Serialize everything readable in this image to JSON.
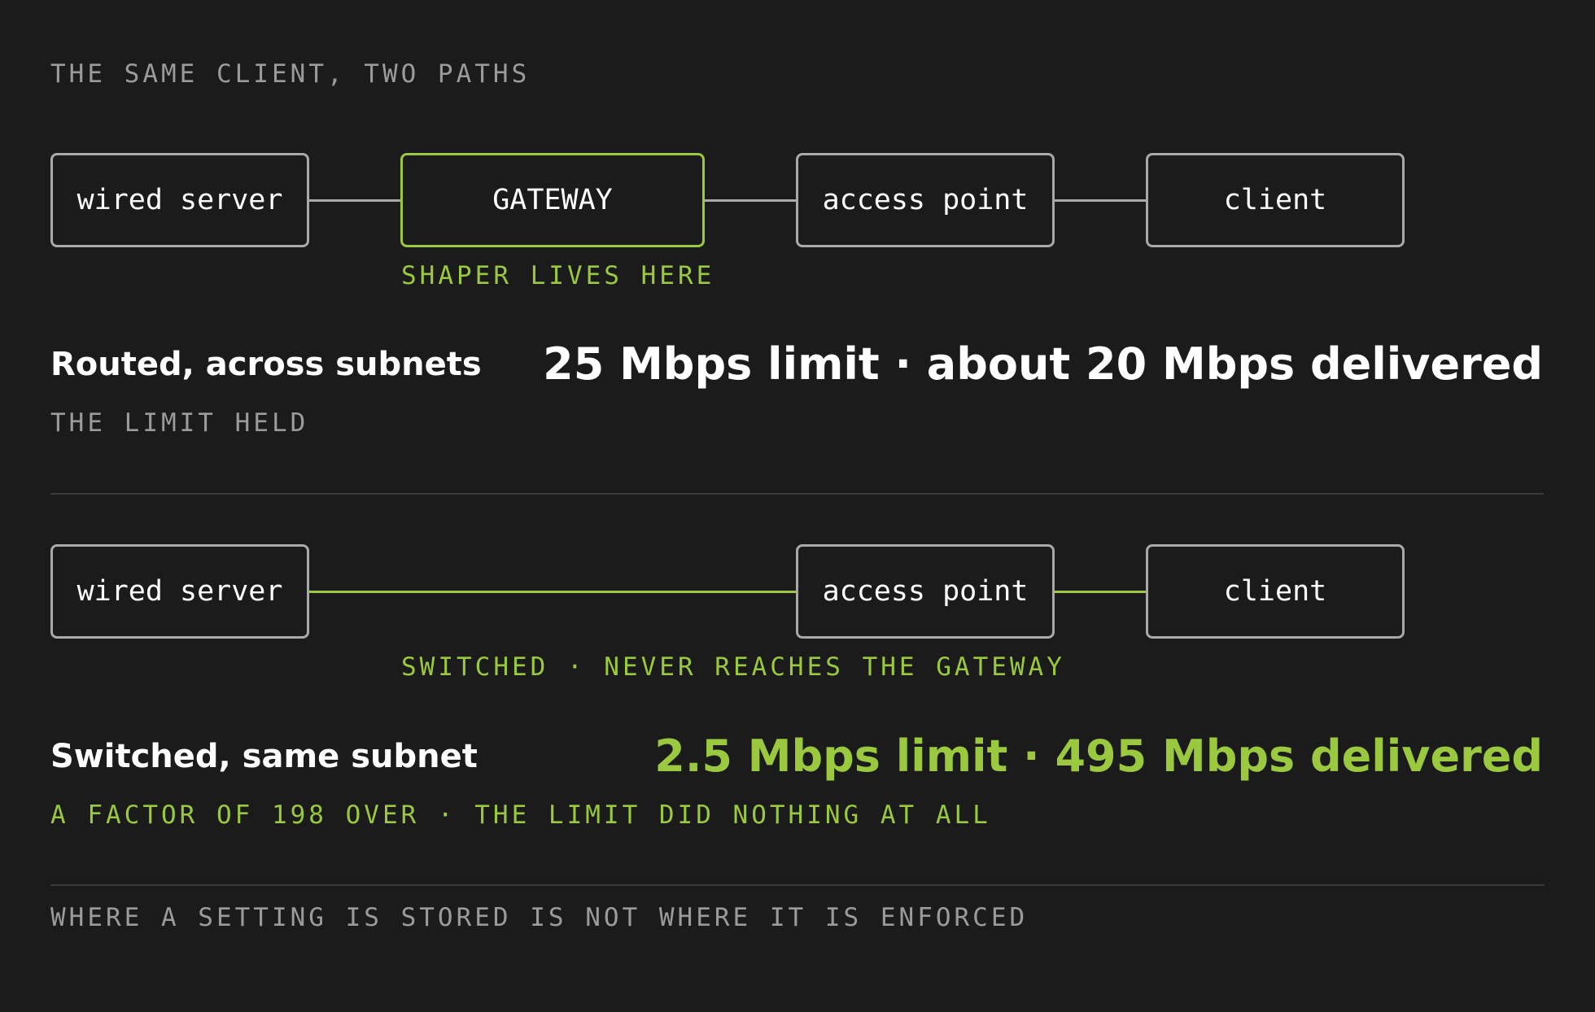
{
  "title": "THE SAME CLIENT, TWO PATHS",
  "routed": {
    "nodes": {
      "server": "wired server",
      "gateway": "GATEWAY",
      "access_point": "access point",
      "client": "client"
    },
    "gateway_note": "SHAPER LIVES HERE",
    "heading": "Routed, across subnets",
    "result": "25 Mbps limit · about 20 Mbps delivered",
    "verdict": "THE LIMIT HELD"
  },
  "switched": {
    "nodes": {
      "server": "wired server",
      "access_point": "access point",
      "client": "client"
    },
    "path_note": "SWITCHED · NEVER REACHES THE GATEWAY",
    "heading": "Switched, same subnet",
    "result": "2.5 Mbps limit · 495 Mbps delivered",
    "verdict": "A FACTOR OF 198 OVER · THE LIMIT DID NOTHING AT ALL"
  },
  "footer": "WHERE A SETTING IS STORED IS NOT WHERE IT IS ENFORCED",
  "colors": {
    "background": "#1b1b1b",
    "accent": "#9ac83f",
    "muted": "#9b9b9b",
    "border": "#a9a9a9",
    "text": "#ffffff"
  }
}
